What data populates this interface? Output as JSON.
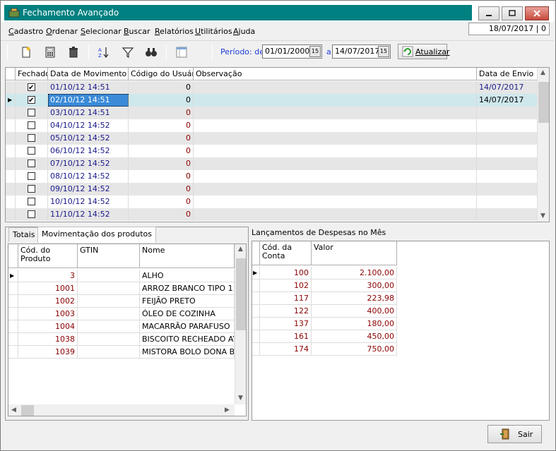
{
  "window": {
    "title": "Fechamento Avançado",
    "date_status": "18/07/2017 | 0"
  },
  "menu": [
    "Cadastro",
    "Ordenar",
    "Selecionar",
    "Buscar",
    "Relatórios",
    "Utilitários",
    "Ajuda"
  ],
  "toolbar": {
    "icons": [
      "new-icon",
      "calculator-icon",
      "trash-icon",
      "sort-az-icon",
      "filter-icon",
      "binoculars-icon",
      "columns-icon"
    ],
    "periodo_label": "Período: de",
    "date_from": "01/01/2000",
    "a_label": "a",
    "date_to": "14/07/2017",
    "atualizar_label": "Atualizar",
    "cal_glyph": "15"
  },
  "main_grid": {
    "columns": [
      "Fechado",
      "Data de Movimento",
      "Código do Usuário",
      "Observação",
      "Data de Envio"
    ],
    "rows": [
      {
        "fechado": true,
        "data": "01/10/12 14:51",
        "codigo": "0",
        "obs": "",
        "envio": "14/07/2017"
      },
      {
        "fechado": true,
        "data": "02/10/12 14:51",
        "codigo": "0",
        "obs": "",
        "envio": "14/07/2017"
      },
      {
        "fechado": false,
        "data": "03/10/12 14:51",
        "codigo": "0",
        "obs": "",
        "envio": ""
      },
      {
        "fechado": false,
        "data": "04/10/12 14:52",
        "codigo": "0",
        "obs": "",
        "envio": ""
      },
      {
        "fechado": false,
        "data": "05/10/12 14:52",
        "codigo": "0",
        "obs": "",
        "envio": ""
      },
      {
        "fechado": false,
        "data": "06/10/12 14:52",
        "codigo": "0",
        "obs": "",
        "envio": ""
      },
      {
        "fechado": false,
        "data": "07/10/12 14:52",
        "codigo": "0",
        "obs": "",
        "envio": ""
      },
      {
        "fechado": false,
        "data": "08/10/12 14:52",
        "codigo": "0",
        "obs": "",
        "envio": ""
      },
      {
        "fechado": false,
        "data": "09/10/12 14:52",
        "codigo": "0",
        "obs": "",
        "envio": ""
      },
      {
        "fechado": false,
        "data": "10/10/12 14:52",
        "codigo": "0",
        "obs": "",
        "envio": ""
      },
      {
        "fechado": false,
        "data": "11/10/12 14:52",
        "codigo": "0",
        "obs": "",
        "envio": ""
      }
    ]
  },
  "tabs": [
    "Totais",
    "Movimentação dos produtos"
  ],
  "produtos_grid": {
    "columns": [
      "Cód. do Produto",
      "GTIN",
      "Nome"
    ],
    "rows": [
      {
        "cod": "3",
        "gtin": "",
        "nome": "ALHO"
      },
      {
        "cod": "1001",
        "gtin": "",
        "nome": "ARROZ BRANCO TIPO 1"
      },
      {
        "cod": "1002",
        "gtin": "",
        "nome": "FEIJÃO PRETO"
      },
      {
        "cod": "1003",
        "gtin": "",
        "nome": "ÓLEO DE COZINHA"
      },
      {
        "cod": "1004",
        "gtin": "",
        "nome": "MACARRÃO PARAFUSO"
      },
      {
        "cod": "1038",
        "gtin": "",
        "nome": "BISCOITO RECHEADO AYI"
      },
      {
        "cod": "1039",
        "gtin": "",
        "nome": "MISTORA BOLO DONA BE"
      }
    ]
  },
  "despesas": {
    "title": "Lançamentos de Despesas no Mês",
    "columns": [
      "Cód. da Conta",
      "Valor"
    ],
    "rows": [
      {
        "conta": "100",
        "valor": "2.100,00"
      },
      {
        "conta": "102",
        "valor": "300,00"
      },
      {
        "conta": "117",
        "valor": "223,98"
      },
      {
        "conta": "122",
        "valor": "400,00"
      },
      {
        "conta": "137",
        "valor": "180,00"
      },
      {
        "conta": "161",
        "valor": "450,00"
      },
      {
        "conta": "174",
        "valor": "750,00"
      }
    ]
  },
  "footer": {
    "sair_label": "Sair"
  },
  "colors": {
    "title_bg": "#008080",
    "date_text": "#1a1a8c",
    "code_text": "#8b0000",
    "row_alt": "#e6e6e6",
    "row_selected": "#cfe8ec"
  }
}
